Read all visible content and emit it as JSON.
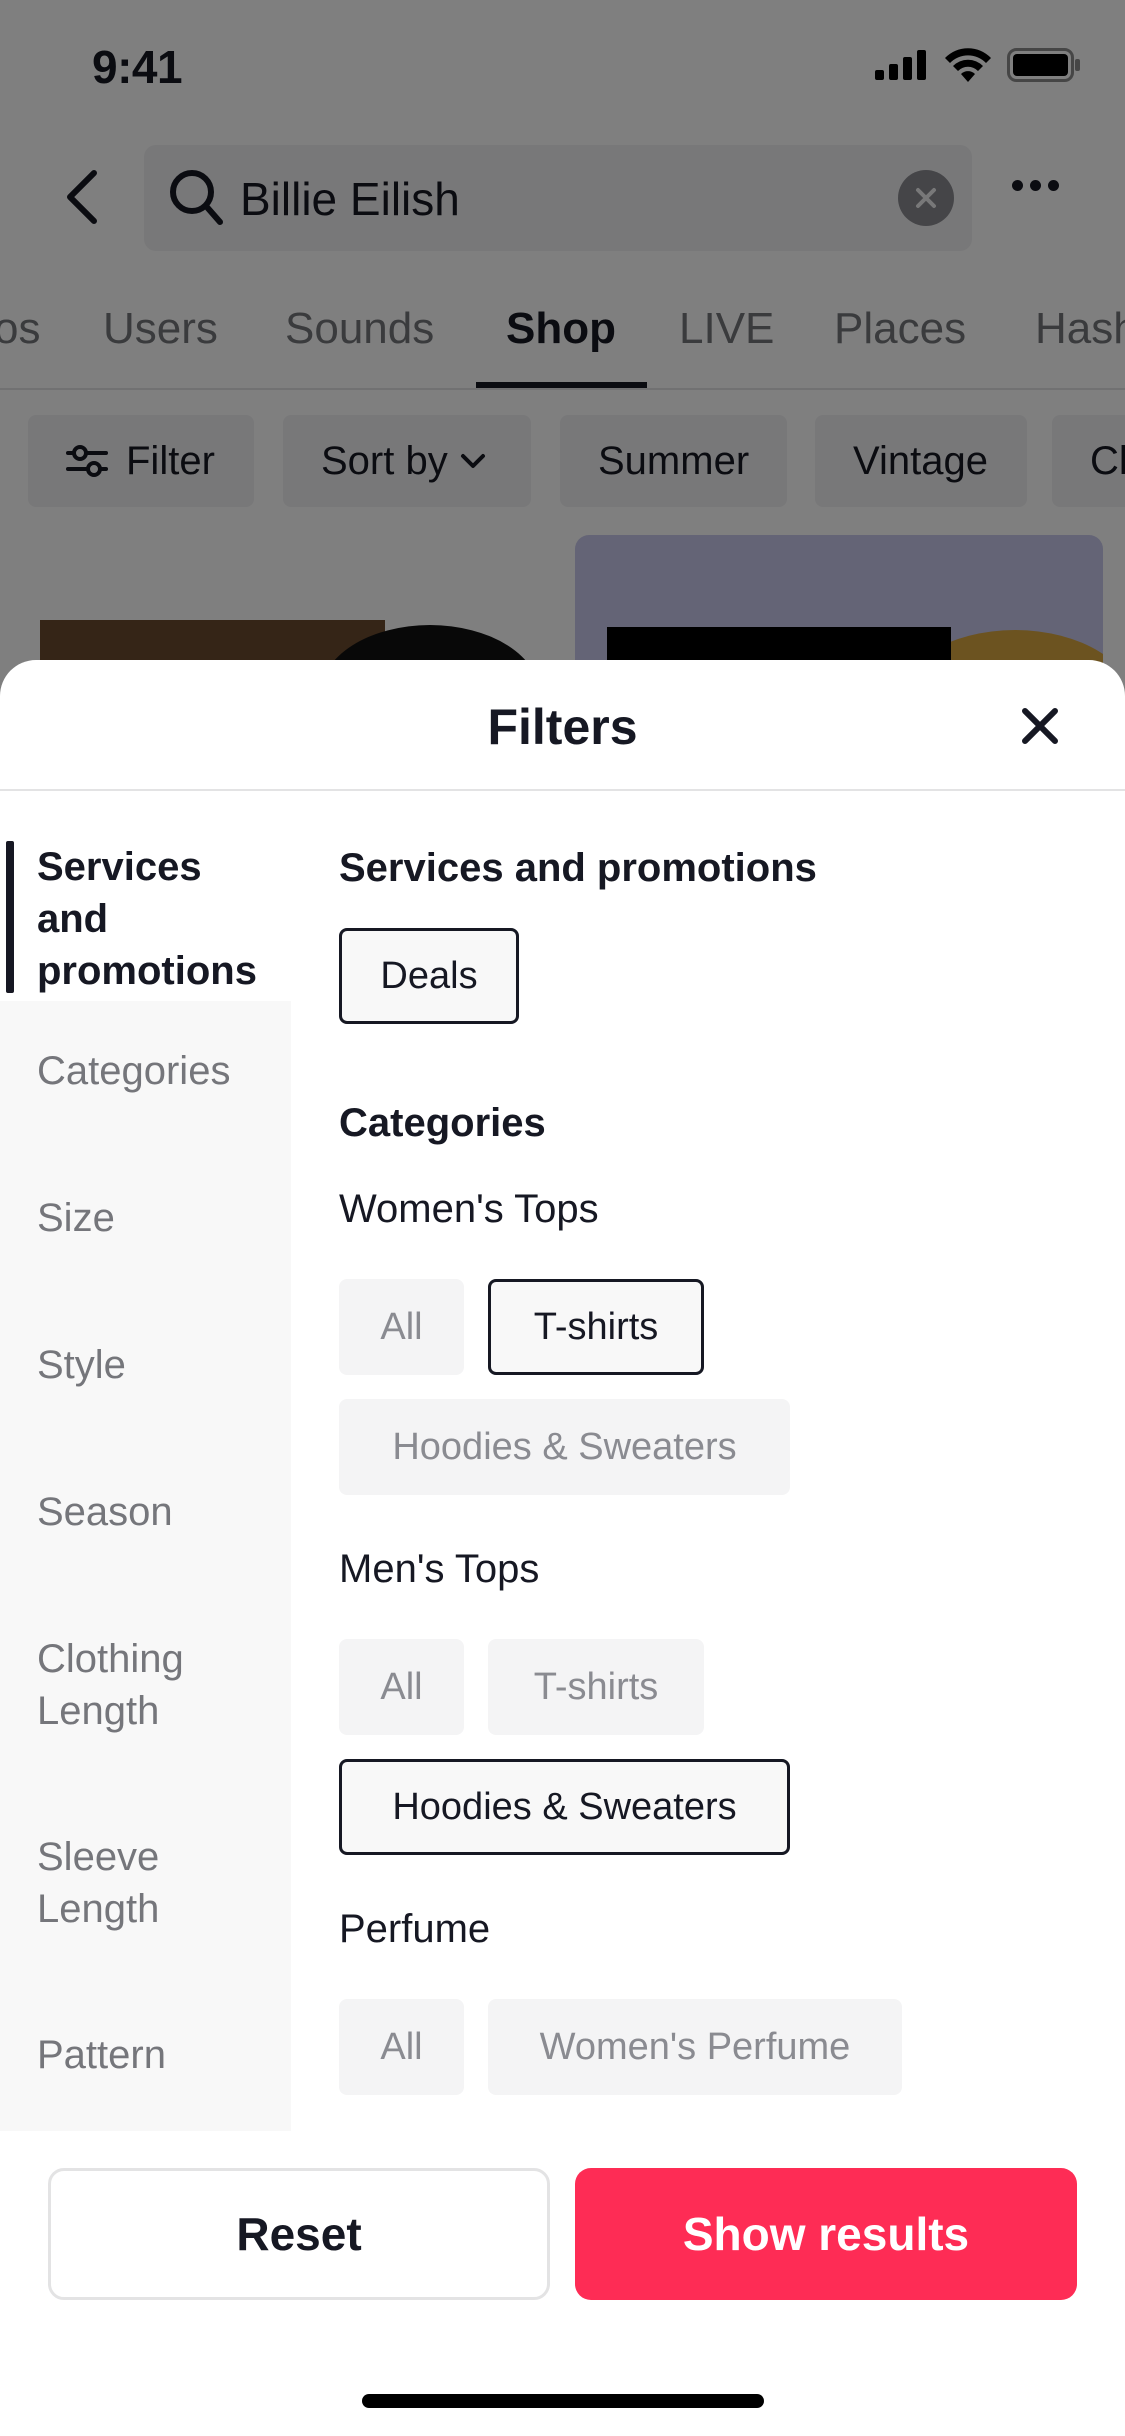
{
  "status_bar": {
    "time": "9:41"
  },
  "search": {
    "query": "Billie Eilish"
  },
  "tabs": [
    {
      "label": "os"
    },
    {
      "label": "Users"
    },
    {
      "label": "Sounds"
    },
    {
      "label": "Shop"
    },
    {
      "label": "LIVE"
    },
    {
      "label": "Places"
    },
    {
      "label": "Hash"
    }
  ],
  "active_tab": "Shop",
  "chips": [
    {
      "label": "Filter"
    },
    {
      "label": "Sort by"
    },
    {
      "label": "Summer"
    },
    {
      "label": "Vintage"
    },
    {
      "label": "Cl"
    }
  ],
  "sheet": {
    "title": "Filters",
    "nav": [
      {
        "label": "Services and promotions",
        "active": true
      },
      {
        "label": "Categories"
      },
      {
        "label": "Size"
      },
      {
        "label": "Style"
      },
      {
        "label": "Season"
      },
      {
        "label": "Clothing Length"
      },
      {
        "label": "Sleeve Length"
      },
      {
        "label": "Pattern"
      }
    ],
    "services": {
      "title": "Services and promotions",
      "options": [
        {
          "label": "Deals",
          "selected": true
        }
      ]
    },
    "categories": {
      "title": "Categories",
      "groups": [
        {
          "name": "Women's Tops",
          "options": [
            {
              "label": "All",
              "selected": false
            },
            {
              "label": "T-shirts",
              "selected": true
            },
            {
              "label": "Hoodies & Sweaters",
              "selected": false
            }
          ]
        },
        {
          "name": "Men's Tops",
          "options": [
            {
              "label": "All",
              "selected": false
            },
            {
              "label": "T-shirts",
              "selected": false
            },
            {
              "label": "Hoodies & Sweaters",
              "selected": true
            }
          ]
        },
        {
          "name": "Perfume",
          "options": [
            {
              "label": "All",
              "selected": false
            },
            {
              "label": "Women's Perfume",
              "selected": false
            }
          ]
        }
      ]
    },
    "footer": {
      "reset_label": "Reset",
      "show_label": "Show results"
    }
  },
  "colors": {
    "accent": "#fe2c55",
    "text": "#161823",
    "muted": "#8a8b91"
  }
}
